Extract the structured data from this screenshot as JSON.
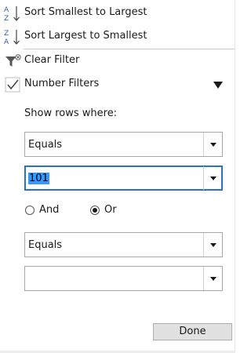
{
  "menu": {
    "sort_asc": {
      "label": "Sort Smallest to Largest",
      "icon": "sort-ascending-icon"
    },
    "sort_desc": {
      "label": "Sort Largest to Smallest",
      "icon": "sort-descending-icon"
    },
    "clear_filter": {
      "label": "Clear Filter",
      "icon": "clear-filter-icon"
    },
    "number_filters": {
      "label": "Number Filters",
      "icon": "checkmark-icon",
      "checked": true
    }
  },
  "filter": {
    "show_rows_label": "Show rows where:",
    "condition1": {
      "operator": "Equals",
      "value": "101"
    },
    "logic": {
      "and_label": "And",
      "or_label": "Or",
      "selected": "Or"
    },
    "condition2": {
      "operator": "Equals",
      "value": ""
    }
  },
  "done_label": "Done",
  "colors": {
    "accent": "#2b79d6",
    "selection": "#3399ff",
    "az_icon": "#3a5ba0"
  }
}
